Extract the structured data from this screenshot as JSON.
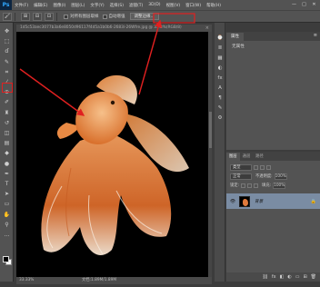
{
  "app": {
    "logo": "Ps",
    "menu": [
      "文件(F)",
      "编辑(E)",
      "图像(I)",
      "图层(L)",
      "文字(Y)",
      "选择(S)",
      "滤镜(T)",
      "3D(D)",
      "视图(V)",
      "窗口(W)",
      "帮助(H)"
    ],
    "window_controls": [
      "—",
      "□",
      "✕"
    ]
  },
  "options": {
    "tool_icon": "🖌",
    "mode_icons": [
      "⊞",
      "⊟",
      "⊡"
    ],
    "check1_label": "对所有图层取样",
    "check2_label": "自动增强",
    "refine_button": "调整边缘..."
  },
  "toolbar": {
    "tools": [
      {
        "name": "move-tool-icon",
        "glyph": "✥"
      },
      {
        "name": "marquee-tool-icon",
        "glyph": "⬚"
      },
      {
        "name": "lasso-tool-icon",
        "glyph": "ɗ"
      },
      {
        "name": "quick-selection-tool-icon",
        "glyph": "✎"
      },
      {
        "name": "crop-tool-icon",
        "glyph": "⌗"
      },
      {
        "name": "eyedropper-tool-icon",
        "glyph": "⁄"
      },
      {
        "name": "healing-brush-tool-icon",
        "glyph": "⊕"
      },
      {
        "name": "brush-tool-icon",
        "glyph": "✐"
      },
      {
        "name": "clone-stamp-tool-icon",
        "glyph": "♜"
      },
      {
        "name": "history-brush-tool-icon",
        "glyph": "↺"
      },
      {
        "name": "eraser-tool-icon",
        "glyph": "◫"
      },
      {
        "name": "gradient-tool-icon",
        "glyph": "▤"
      },
      {
        "name": "blur-tool-icon",
        "glyph": "◆"
      },
      {
        "name": "dodge-tool-icon",
        "glyph": "●"
      },
      {
        "name": "pen-tool-icon",
        "glyph": "✒"
      },
      {
        "name": "type-tool-icon",
        "glyph": "T"
      },
      {
        "name": "path-selection-tool-icon",
        "glyph": "➤"
      },
      {
        "name": "shape-tool-icon",
        "glyph": "▭"
      },
      {
        "name": "hand-tool-icon",
        "glyph": "✋"
      },
      {
        "name": "zoom-tool-icon",
        "glyph": "⚲"
      },
      {
        "name": "more-tools-icon",
        "glyph": "…"
      }
    ]
  },
  "document": {
    "tab_title": "1d5c53aec3077b3a6e8050d96117f4d5a1b0b6-2683i-26Wfre.jpg @ 33.3%(RGB/8)",
    "tab_close": "×",
    "zoom": "33.33%",
    "doc_info": "文档:1.89M/1.89M"
  },
  "dock": {
    "icons": [
      {
        "name": "history-panel-icon",
        "glyph": "⌚"
      },
      {
        "name": "properties-panel-icon",
        "glyph": "≣"
      },
      {
        "name": "swatches-panel-icon",
        "glyph": "▦"
      },
      {
        "name": "adjustments-panel-icon",
        "glyph": "◐"
      },
      {
        "name": "styles-panel-icon",
        "glyph": "fx"
      },
      {
        "name": "character-panel-icon",
        "glyph": "A"
      },
      {
        "name": "paragraph-panel-icon",
        "glyph": "¶"
      },
      {
        "name": "brush-panel-icon",
        "glyph": "✎"
      },
      {
        "name": "tool-presets-icon",
        "glyph": "⚙"
      }
    ]
  },
  "properties": {
    "tab": "属性",
    "menu": "≡",
    "empty_text": "无属性"
  },
  "layers": {
    "tabs": [
      "图层",
      "通道",
      "路径"
    ],
    "active_tab": 0,
    "filter": "类型",
    "blend_mode": "正常",
    "opacity_label": "不透明度:",
    "opacity": "100%",
    "lock_label": "锁定:",
    "fill_label": "填充:",
    "fill": "100%",
    "layer_name": "背景",
    "eye_glyph": "👁",
    "lock_glyph": "🔒",
    "footer_icons": [
      "⛓",
      "fx",
      "◧",
      "◐",
      "▭",
      "⊞",
      "🗑"
    ]
  },
  "colors": {
    "annotation_red": "#e02020",
    "fish_orange": "#e07a3c",
    "layer_selected": "#7a8ca3"
  }
}
